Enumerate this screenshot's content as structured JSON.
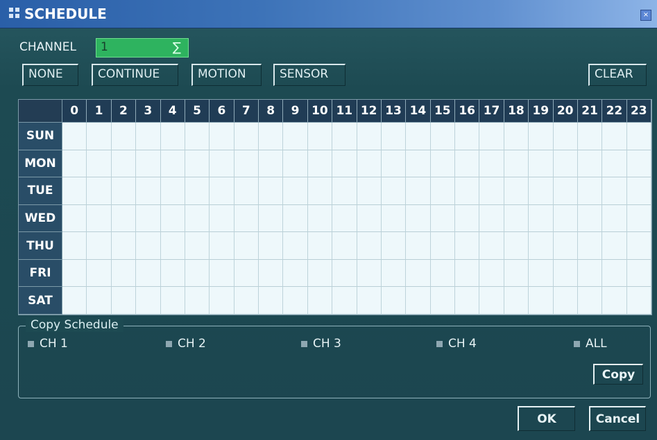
{
  "window": {
    "title": "SCHEDULE",
    "close": "×"
  },
  "channel": {
    "label": "CHANNEL",
    "value": "1",
    "arrow": "∑"
  },
  "modes": [
    "NONE",
    "CONTINUE",
    "MOTION",
    "SENSOR"
  ],
  "clear": "CLEAR",
  "grid": {
    "hours": [
      "0",
      "1",
      "2",
      "3",
      "4",
      "5",
      "6",
      "7",
      "8",
      "9",
      "10",
      "11",
      "12",
      "13",
      "14",
      "15",
      "16",
      "17",
      "18",
      "19",
      "20",
      "21",
      "22",
      "23"
    ],
    "days": [
      "SUN",
      "MON",
      "TUE",
      "WED",
      "THU",
      "FRI",
      "SAT"
    ]
  },
  "copy_schedule": {
    "title": "Copy Schedule",
    "options": [
      "CH 1",
      "CH 2",
      "CH 3",
      "CH 4",
      "ALL"
    ],
    "button": "Copy"
  },
  "footer": {
    "ok": "OK",
    "cancel": "Cancel"
  }
}
